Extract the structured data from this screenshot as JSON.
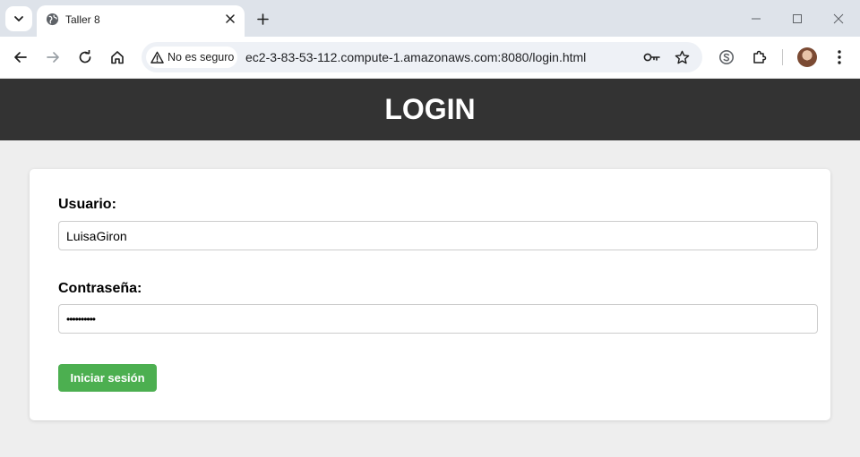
{
  "browser": {
    "tab": {
      "title": "Taller 8"
    },
    "security_chip": "No es seguro",
    "url": "ec2-3-83-53-112.compute-1.amazonaws.com:8080/login.html"
  },
  "page": {
    "header": {
      "title": "LOGIN"
    },
    "form": {
      "username_label": "Usuario:",
      "username_value": "LuisaGiron",
      "password_label": "Contraseña:",
      "password_value": "••••••••••",
      "submit_label": "Iniciar sesión"
    }
  },
  "colors": {
    "header_bg": "#333333",
    "button_bg": "#4caf50",
    "page_bg": "#eeeeee"
  }
}
